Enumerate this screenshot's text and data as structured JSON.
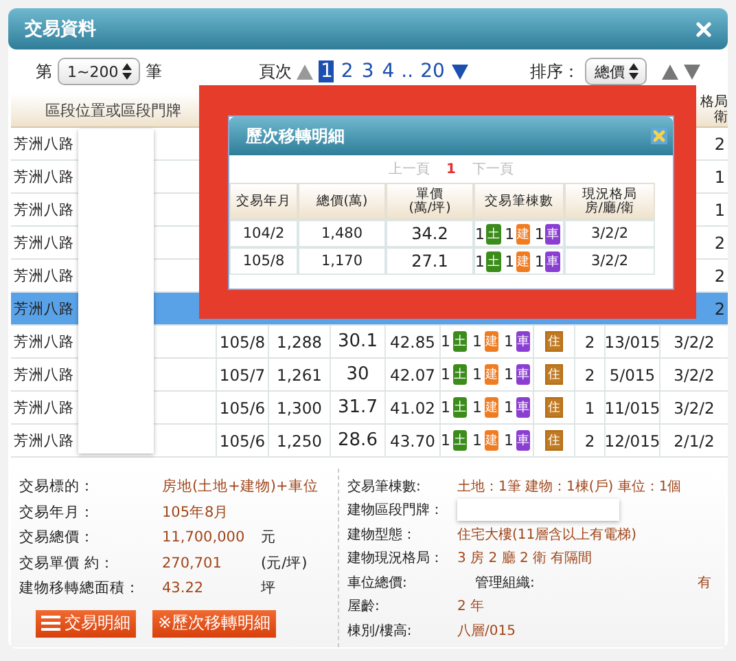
{
  "window": {
    "title": "交易資料"
  },
  "controls": {
    "range_prefix": "第",
    "range_value": "1~200",
    "range_suffix": "筆",
    "pages_label": "頁次",
    "pages": [
      {
        "kind": "page",
        "label": "1",
        "selected": true
      },
      {
        "kind": "page",
        "label": "2",
        "selected": false
      },
      {
        "kind": "page",
        "label": "3",
        "selected": false
      },
      {
        "kind": "page",
        "label": "4",
        "selected": false
      },
      {
        "kind": "gap",
        "label": ".."
      },
      {
        "kind": "page",
        "label": "20",
        "selected": false
      }
    ],
    "sort_label": "排序：",
    "sort_value": "總價"
  },
  "table": {
    "header": {
      "address": "區段位置或區段門牌",
      "layout_lines": [
        "格局",
        "衛"
      ]
    },
    "rows": [
      {
        "address": "芳洲八路",
        "selected": false,
        "layout": "2"
      },
      {
        "address": "芳洲八路",
        "selected": false,
        "layout": "1"
      },
      {
        "address": "芳洲八路",
        "selected": false,
        "layout": "1"
      },
      {
        "address": "芳洲八路",
        "selected": false,
        "layout": "2"
      },
      {
        "address": "芳洲八路",
        "selected": false,
        "layout": "2"
      },
      {
        "address": "芳洲八路",
        "selected": true,
        "layout": "2"
      },
      {
        "address": "芳洲八路",
        "selected": false,
        "date": "105/8",
        "total": "1,288",
        "unit_price": "30.1",
        "column_5": "42.85",
        "lots": [
          {
            "count": "1",
            "label": "土",
            "color": "#3c8c1c"
          },
          {
            "count": "1",
            "label": "建",
            "color": "#f07c22"
          },
          {
            "count": "1",
            "label": "車",
            "color": "#8b3fd2"
          }
        ],
        "usage": "住",
        "column_8": "2",
        "column_9": "13/015",
        "layout": "3/2/2"
      },
      {
        "address": "芳洲八路",
        "selected": false,
        "date": "105/7",
        "total": "1,261",
        "unit_price": "30",
        "column_5": "42.07",
        "lots": [
          {
            "count": "1",
            "label": "土",
            "color": "#3c8c1c"
          },
          {
            "count": "1",
            "label": "建",
            "color": "#f07c22"
          },
          {
            "count": "1",
            "label": "車",
            "color": "#8b3fd2"
          }
        ],
        "usage": "住",
        "column_8": "2",
        "column_9": "5/015",
        "layout": "3/2/2"
      },
      {
        "address": "芳洲八路",
        "selected": false,
        "date": "105/6",
        "total": "1,300",
        "unit_price": "31.7",
        "column_5": "41.02",
        "lots": [
          {
            "count": "1",
            "label": "土",
            "color": "#3c8c1c"
          },
          {
            "count": "1",
            "label": "建",
            "color": "#f07c22"
          },
          {
            "count": "1",
            "label": "車",
            "color": "#8b3fd2"
          }
        ],
        "usage": "住",
        "column_8": "1",
        "column_9": "11/015",
        "layout": "3/2/2"
      },
      {
        "address": "芳洲八路",
        "selected": false,
        "date": "105/6",
        "total": "1,250",
        "unit_price": "28.6",
        "column_5": "43.70",
        "lots": [
          {
            "count": "1",
            "label": "土",
            "color": "#3c8c1c"
          },
          {
            "count": "1",
            "label": "建",
            "color": "#f07c22"
          },
          {
            "count": "1",
            "label": "車",
            "color": "#8b3fd2"
          }
        ],
        "usage": "住",
        "column_8": "2",
        "column_9": "12/015",
        "layout": "2/1/2"
      }
    ]
  },
  "popup": {
    "title": "歷次移轉明細",
    "pager": {
      "prev": "上一頁",
      "current": "1",
      "next": "下一頁"
    },
    "columns": [
      {
        "lines": [
          "交易年月"
        ]
      },
      {
        "lines": [
          "總價(萬)"
        ]
      },
      {
        "lines": [
          "單價",
          "(萬/坪)"
        ]
      },
      {
        "lines": [
          "交易筆棟數"
        ]
      },
      {
        "lines": [
          "現況格局",
          "房/廳/衛"
        ]
      }
    ],
    "rows": [
      {
        "date": "104/2",
        "total": "1,480",
        "unit_price": "34.2",
        "lots": [
          {
            "count": "1",
            "label": "土",
            "color": "#3c8c1c"
          },
          {
            "count": "1",
            "label": "建",
            "color": "#f07c22"
          },
          {
            "count": "1",
            "label": "車",
            "color": "#8b3fd2"
          }
        ],
        "layout": "3/2/2"
      },
      {
        "date": "105/8",
        "total": "1,170",
        "unit_price": "27.1",
        "lots": [
          {
            "count": "1",
            "label": "土",
            "color": "#3c8c1c"
          },
          {
            "count": "1",
            "label": "建",
            "color": "#f07c22"
          },
          {
            "count": "1",
            "label": "車",
            "color": "#8b3fd2"
          }
        ],
        "layout": "3/2/2"
      }
    ]
  },
  "details": {
    "left": [
      {
        "label": "交易標的：",
        "value": "房地(土地+建物)+車位"
      },
      {
        "label": "交易年月：",
        "value": "105年8月"
      },
      {
        "label": "交易總價：",
        "value": "11,700,000",
        "unit": "元"
      },
      {
        "label": "交易單價 約：",
        "value": "270,701",
        "unit": "(元/坪)"
      },
      {
        "label": "建物移轉總面積：",
        "value": "43.22",
        "unit": "坪"
      }
    ],
    "buttons": [
      {
        "kind": "list",
        "label": "交易明細"
      },
      {
        "kind": "plain",
        "label": "※歷次移轉明細"
      }
    ],
    "right": [
      {
        "kind": "text",
        "label": "交易筆棟數:",
        "value": "土地：1筆 建物：1棟(戶) 車位：1個"
      },
      {
        "kind": "redacted",
        "label": "建物區段門牌："
      },
      {
        "kind": "text",
        "label": "建物型態：",
        "value": "住宅大樓(11層含以上有電梯)"
      },
      {
        "kind": "text",
        "label": "建物現況格局：",
        "value": "3 房 2 廳 2 衛 有隔間"
      },
      {
        "kind": "pair",
        "label": "車位總價:",
        "extra_label": "管理組織:",
        "extra_value": "有"
      },
      {
        "kind": "text",
        "label": "屋齡:",
        "value": "2 年"
      },
      {
        "kind": "text",
        "label": "棟別/樓高:",
        "value": "八層/015"
      }
    ]
  }
}
